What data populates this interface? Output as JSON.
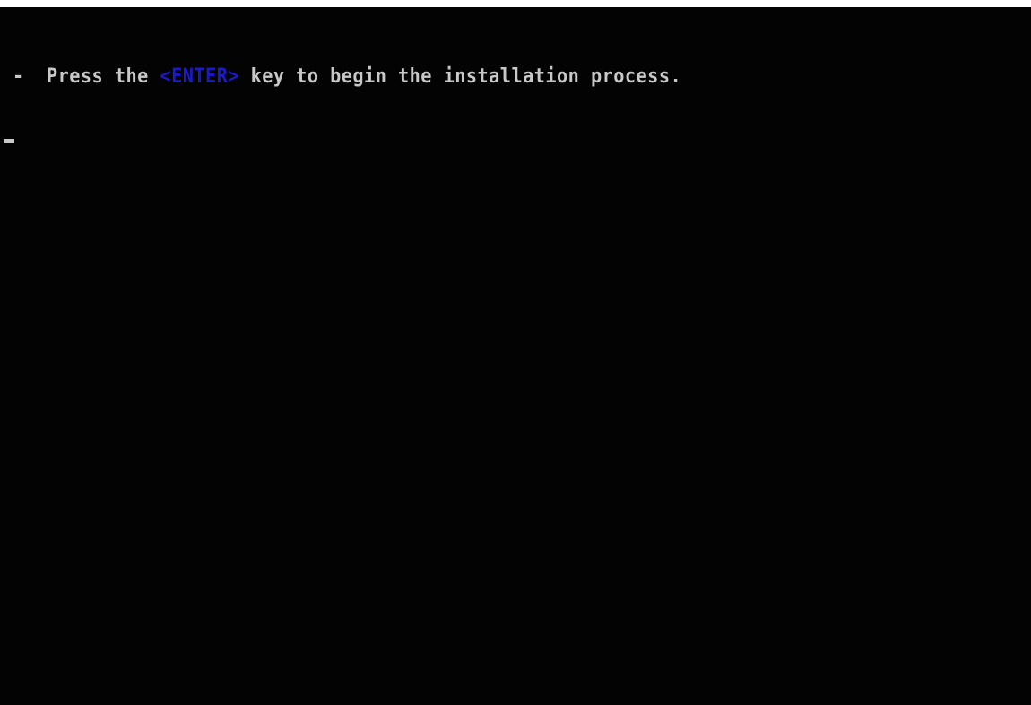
{
  "console": {
    "bullet": "-",
    "text_before": "Press the",
    "key_label": "<ENTER>",
    "text_after": "key to begin the installation process."
  },
  "colors": {
    "background": "#030303",
    "text": "#c8c8c8",
    "key_highlight": "#1a1acc"
  }
}
